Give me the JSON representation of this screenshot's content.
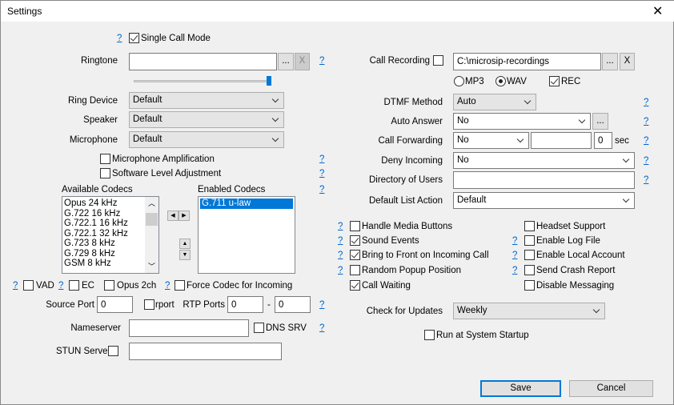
{
  "window": {
    "title": "Settings",
    "close": "✕"
  },
  "help": "?",
  "single_call_mode": {
    "label": "Single Call Mode",
    "checked": true
  },
  "ringtone": {
    "label": "Ringtone",
    "value": "",
    "browse": "...",
    "clear": "X",
    "volume_percent": 97
  },
  "ring_device": {
    "label": "Ring Device",
    "value": "Default"
  },
  "speaker": {
    "label": "Speaker",
    "value": "Default"
  },
  "microphone": {
    "label": "Microphone",
    "value": "Default"
  },
  "mic_amplification": {
    "label": "Microphone Amplification",
    "checked": false
  },
  "software_level": {
    "label": "Software Level Adjustment",
    "checked": false
  },
  "codecs": {
    "available_label": "Available Codecs",
    "enabled_label": "Enabled Codecs",
    "available": [
      "Opus 24 kHz",
      "G.722 16 kHz",
      "G.722.1 16 kHz",
      "G.722.1 32 kHz",
      "G.723 8 kHz",
      "G.729 8 kHz",
      "GSM 8 kHz"
    ],
    "enabled": [
      "G.711 u-law"
    ]
  },
  "vad": {
    "label": "VAD",
    "checked": false
  },
  "ec": {
    "label": "EC",
    "checked": false
  },
  "opus2ch": {
    "label": "Opus 2ch",
    "checked": false
  },
  "force_codec": {
    "label": "Force Codec for Incoming",
    "checked": false
  },
  "source_port": {
    "label": "Source Port",
    "value": "0"
  },
  "rport": {
    "label": "rport",
    "checked": false
  },
  "rtp_ports": {
    "label": "RTP Ports",
    "from": "0",
    "sep": "-",
    "to": "0"
  },
  "nameserver": {
    "label": "Nameserver",
    "value": ""
  },
  "dns_srv": {
    "label": "DNS SRV",
    "checked": false
  },
  "stun": {
    "label": "STUN Server",
    "value": "",
    "checked": false
  },
  "call_recording": {
    "label": "Call Recording",
    "checked": false,
    "path": "C:\\microsip-recordings",
    "browse": "...",
    "clear": "X",
    "mp3": "MP3",
    "wav": "WAV",
    "format": "WAV",
    "rec": "REC",
    "rec_checked": true
  },
  "dtmf": {
    "label": "DTMF Method",
    "value": "Auto"
  },
  "auto_answer": {
    "label": "Auto Answer",
    "value": "No",
    "more": "..."
  },
  "call_forwarding": {
    "label": "Call Forwarding",
    "value": "No",
    "number": "",
    "delay": "0",
    "unit": "sec"
  },
  "deny_incoming": {
    "label": "Deny Incoming",
    "value": "No"
  },
  "directory": {
    "label": "Directory of Users",
    "value": ""
  },
  "default_action": {
    "label": "Default List Action",
    "value": "Default"
  },
  "options_left": [
    {
      "label": "Handle Media Buttons",
      "checked": false
    },
    {
      "label": "Sound Events",
      "checked": true
    },
    {
      "label": "Bring to Front on Incoming Call",
      "checked": true
    },
    {
      "label": "Random Popup Position",
      "checked": false
    },
    {
      "label": "Call Waiting",
      "checked": true
    }
  ],
  "options_right": [
    {
      "label": "Headset Support",
      "checked": false
    },
    {
      "label": "Enable Log File",
      "checked": false
    },
    {
      "label": "Enable Local Account",
      "checked": false
    },
    {
      "label": "Send Crash Report",
      "checked": false
    },
    {
      "label": "Disable Messaging",
      "checked": false
    }
  ],
  "updates": {
    "label": "Check for Updates",
    "value": "Weekly"
  },
  "startup": {
    "label": "Run at System Startup",
    "checked": false
  },
  "buttons": {
    "save": "Save",
    "cancel": "Cancel"
  }
}
